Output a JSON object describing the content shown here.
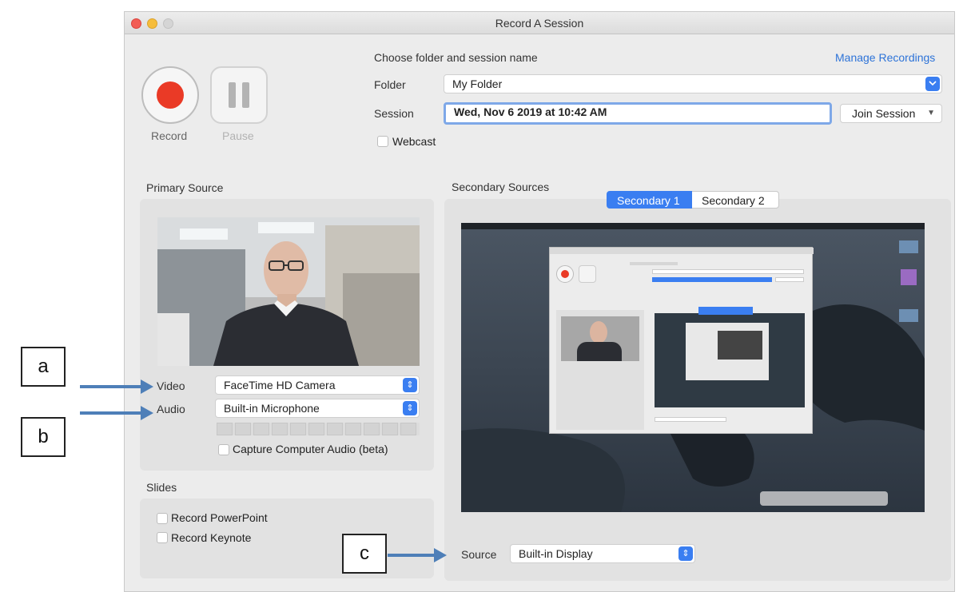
{
  "window": {
    "title": "Record A Session"
  },
  "controls": {
    "record_label": "Record",
    "pause_label": "Pause"
  },
  "session": {
    "heading": "Choose folder and session name",
    "manage_link": "Manage Recordings",
    "folder_label": "Folder",
    "folder_value": "My Folder",
    "session_label": "Session",
    "session_value": "Wed, Nov 6 2019 at 10:42 AM",
    "join_button": "Join Session",
    "webcast_label": "Webcast"
  },
  "primary": {
    "title": "Primary Source",
    "video_label": "Video",
    "video_value": "FaceTime HD Camera",
    "audio_label": "Audio",
    "audio_value": "Built-in Microphone",
    "capture_audio_label": "Capture Computer Audio (beta)"
  },
  "slides": {
    "title": "Slides",
    "powerpoint_label": "Record PowerPoint",
    "keynote_label": "Record Keynote"
  },
  "secondary": {
    "title": "Secondary Sources",
    "tab1": "Secondary 1",
    "tab2": "Secondary 2",
    "source_label": "Source",
    "source_value": "Built-in Display"
  },
  "callouts": {
    "a": "a",
    "b": "b",
    "c": "c"
  },
  "colors": {
    "accent": "#3a7ef1",
    "record": "#ea3a26",
    "arrow": "#4e7fb8",
    "link": "#2d73d8"
  }
}
